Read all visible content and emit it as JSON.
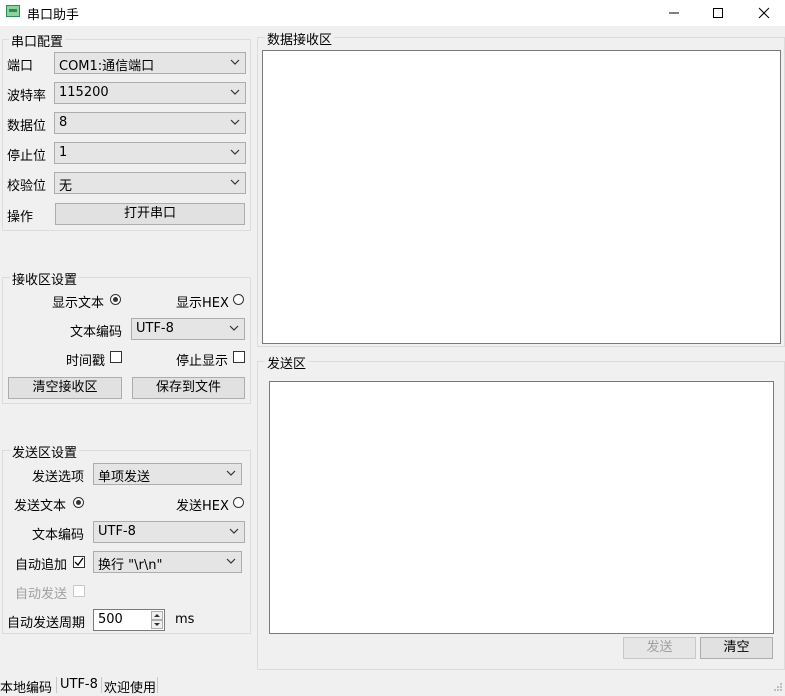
{
  "window": {
    "title": "串口助手"
  },
  "serial_config": {
    "title": "串口配置",
    "port_label": "端口",
    "port_value": "COM1:通信端口",
    "baud_label": "波特率",
    "baud_value": "115200",
    "databits_label": "数据位",
    "databits_value": "8",
    "stopbits_label": "停止位",
    "stopbits_value": "1",
    "parity_label": "校验位",
    "parity_value": "无",
    "action_label": "操作",
    "open_button": "打开串口"
  },
  "receive_settings": {
    "title": "接收区设置",
    "show_text": "显示文本",
    "show_hex": "显示HEX",
    "encoding_label": "文本编码",
    "encoding_value": "UTF-8",
    "timestamp": "时间戳",
    "stop_display": "停止显示",
    "clear_button": "清空接收区",
    "save_button": "保存到文件"
  },
  "send_settings": {
    "title": "发送区设置",
    "send_option_label": "发送选项",
    "send_option_value": "单项发送",
    "send_text": "发送文本",
    "send_hex": "发送HEX",
    "encoding_label": "文本编码",
    "encoding_value": "UTF-8",
    "auto_append_label": "自动追加",
    "auto_append_value": "换行 \"\\r\\n\"",
    "auto_send_label": "自动发送",
    "auto_send_period_label": "自动发送周期",
    "auto_send_period_value": "500",
    "period_unit": "ms"
  },
  "receive_area": {
    "title": "数据接收区"
  },
  "send_area": {
    "title": "发送区",
    "send_button": "发送",
    "clear_button": "清空"
  },
  "status_bar": {
    "encoding_label": "本地编码",
    "encoding_value": "UTF-8",
    "message": "欢迎使用"
  }
}
